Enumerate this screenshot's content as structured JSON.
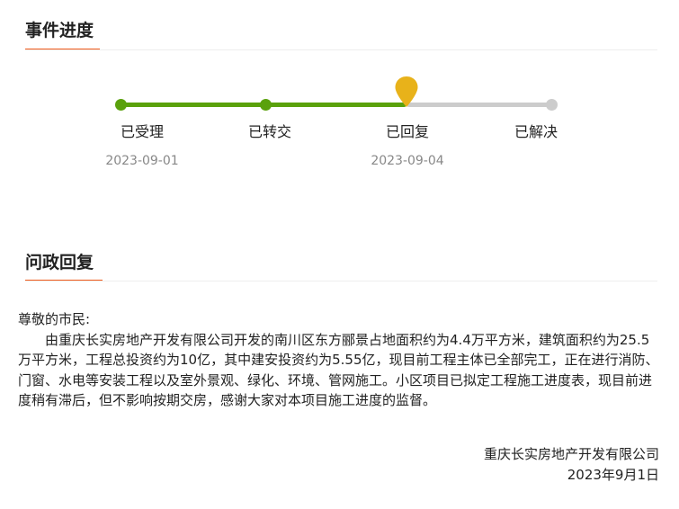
{
  "progress": {
    "title": "事件进度",
    "steps": [
      {
        "label": "已受理",
        "date": "2023-09-01"
      },
      {
        "label": "已转交",
        "date": ""
      },
      {
        "label": "已回复",
        "date": "2023-09-04"
      },
      {
        "label": "已解决",
        "date": ""
      }
    ],
    "current_step_index": 2,
    "colors": {
      "done": "#5aa10c",
      "pending": "#cccccc",
      "marker": "#e8b21a",
      "accent": "#f05a1a"
    }
  },
  "reply": {
    "title": "问政回复",
    "greeting": "尊敬的市民:",
    "body": "由重庆长实房地产开发有限公司开发的南川区东方郦景占地面积约为4.4万平方米，建筑面积约为25.5万平方米，工程总投资约为10亿，其中建安投资约为5.55亿，现目前工程主体已全部完工，正在进行消防、门窗、水电等安装工程以及室外景观、绿化、环境、管网施工。小区项目已拟定工程施工进度表，现目前进度稍有滞后，但不影响按期交房，感谢大家对本项目施工进度的监督。",
    "signature_org": "重庆长实房地产开发有限公司",
    "signature_date": "2023年9月1日"
  }
}
